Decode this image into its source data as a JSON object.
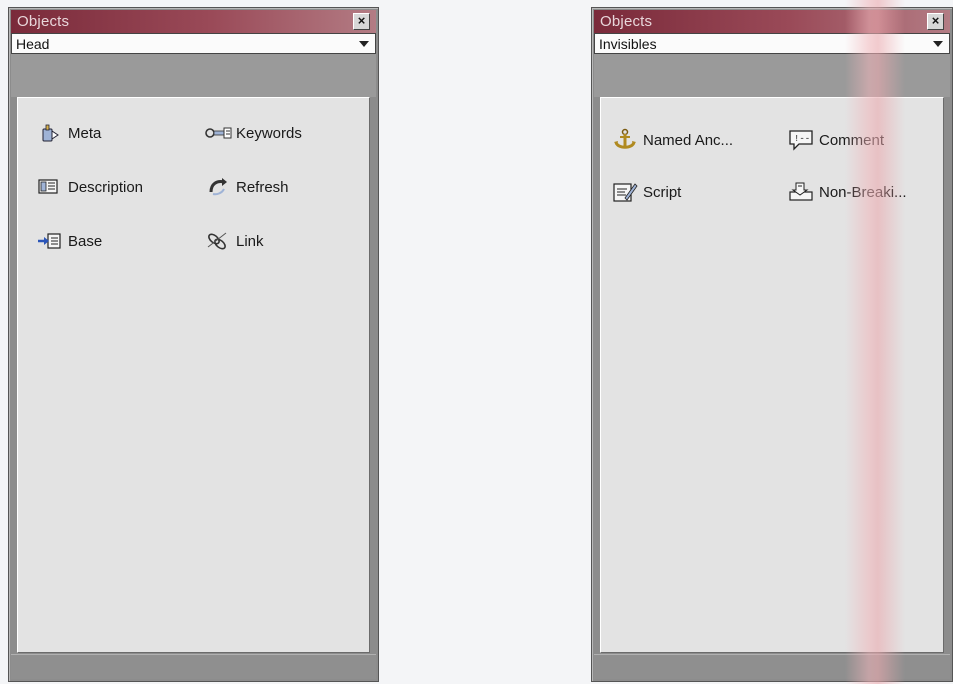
{
  "left_panel": {
    "title": "Objects",
    "close_label": "×",
    "category": "Head",
    "items": [
      {
        "label": "Meta",
        "icon": "meta-icon"
      },
      {
        "label": "Keywords",
        "icon": "keywords-icon"
      },
      {
        "label": "Description",
        "icon": "description-icon"
      },
      {
        "label": "Refresh",
        "icon": "refresh-icon"
      },
      {
        "label": "Base",
        "icon": "base-icon"
      },
      {
        "label": "Link",
        "icon": "link-icon"
      }
    ]
  },
  "right_panel": {
    "title": "Objects",
    "close_label": "×",
    "category": "Invisibles",
    "items": [
      {
        "label": "Named Anc...",
        "icon": "named-anchor-icon"
      },
      {
        "label": "Comment",
        "icon": "comment-icon"
      },
      {
        "label": "Script",
        "icon": "script-icon"
      },
      {
        "label": "Non-Breaki...",
        "icon": "non-breaking-space-icon"
      }
    ]
  },
  "colors": {
    "titlebar": "#7a2a3a",
    "panel_content": "#e3e3e3",
    "panel_frame": "#8c8c8c"
  }
}
